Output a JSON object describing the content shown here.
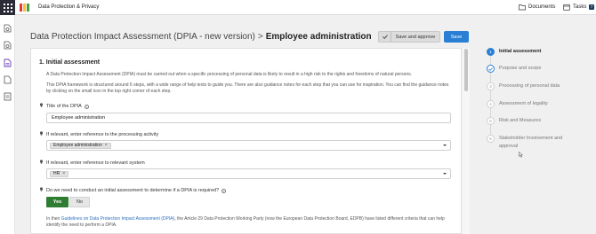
{
  "app": {
    "title": "Data Protection & Privacy"
  },
  "topnav": {
    "documents_label": "Documents",
    "tasks_label": "Tasks",
    "tasks_count": "7"
  },
  "header": {
    "title_prefix": "Data Protection Impact Assessment (DPIA - new version)",
    "separator": ">",
    "title_strong": "Employee administration",
    "approve_label": "Save and approve",
    "save_label": "Save"
  },
  "section": {
    "title": "1. Initial assessment",
    "intro_1": "A Data Protection Impact Assessment (DPIA) must be carried out when a specific processing of personal data is likely to result in a high risk to the rights and freedoms of natural persons.",
    "intro_2": "This DPIA framework is structured around 6 steps, with a wide range of help texts to guide you. There are also guidance notes for each step that you can use for inspiration. You can find the guidance notes by clicking on the small icon in the top right corner of each step."
  },
  "fields": {
    "title_label": "Title of the DPIA",
    "title_value": "Employee administration",
    "activity_label": "If relevant, enter reference to the processing activity",
    "activity_chip": "Employee administration",
    "system_label": "If relevant, enter reference to relevant system",
    "system_chip": "HR",
    "question_label": "Do we need to conduct an initial assessment to determine if a DPIA is required?",
    "yes_label": "Yes",
    "no_label": "No",
    "footer_pre": "In their ",
    "footer_link": "Guidelines on Data Protection Impact Assessment (DPIA)",
    "footer_post": ", the Article 29 Data Protection Working Party (now the European Data Protection Board, EDPB) have listed different criteria that can help identify the need to perform a DPIA."
  },
  "steps": [
    {
      "num": "1",
      "label": "Initial assessment",
      "state": "active"
    },
    {
      "num": "2",
      "label": "Purpose and scope",
      "state": "done"
    },
    {
      "num": "3",
      "label": "Processing of personal data",
      "state": "todo"
    },
    {
      "num": "4",
      "label": "Assessment of legality",
      "state": "todo"
    },
    {
      "num": "5",
      "label": "Risk and Measures",
      "state": "todo"
    },
    {
      "num": "6",
      "label": "Stakeholder Involvement and approval",
      "state": "todo"
    }
  ],
  "colors": {
    "primary": "#2a7fd4",
    "yes_green": "#2f7d32",
    "nav_dark": "#2b2b38"
  }
}
